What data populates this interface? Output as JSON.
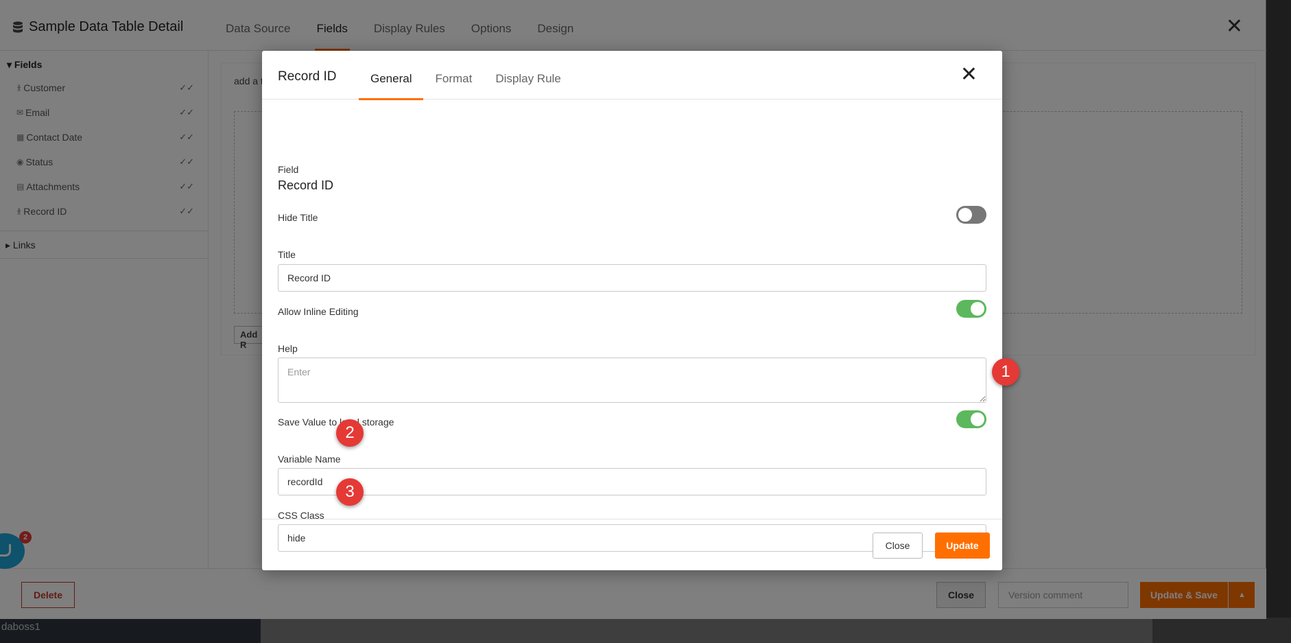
{
  "panel": {
    "title": "Sample Data Table Detail",
    "tabs": [
      "Data Source",
      "Fields",
      "Display Rules",
      "Options",
      "Design"
    ],
    "active_tab": "Fields",
    "close_glyph": "✕"
  },
  "sidebar": {
    "fields_heading": "Fields",
    "items": [
      {
        "label": "Customer",
        "icon": "person-icon"
      },
      {
        "label": "Email",
        "icon": "mail-icon"
      },
      {
        "label": "Contact Date",
        "icon": "calendar-icon"
      },
      {
        "label": "Status",
        "icon": "circle-dot-icon"
      },
      {
        "label": "Attachments",
        "icon": "file-icon"
      },
      {
        "label": "Record ID",
        "icon": "person-icon"
      }
    ],
    "links_heading": "Links"
  },
  "content": {
    "hint": "add a t",
    "add_button": "Add R"
  },
  "footer": {
    "delete": "Delete",
    "close": "Close",
    "version_placeholder": "Version comment",
    "update_save": "Update & Save"
  },
  "user_strip": "daboss1",
  "chat_badge": "2",
  "modal": {
    "title": "Record ID",
    "tabs": [
      "General",
      "Format",
      "Display Rule"
    ],
    "active_tab": "General",
    "field_label": "Field",
    "field_value": "Record ID",
    "hide_title_label": "Hide Title",
    "hide_title_on": false,
    "title_label": "Title",
    "title_value": "Record ID",
    "inline_edit_label": "Allow Inline Editing",
    "inline_edit_on": true,
    "help_label": "Help",
    "help_placeholder": "Enter",
    "save_local_label": "Save Value to local storage",
    "save_local_on": true,
    "variable_label": "Variable Name",
    "variable_value": "recordId",
    "css_label": "CSS Class",
    "css_value": "hide",
    "close_button": "Close",
    "update_button": "Update"
  },
  "markers": [
    "1",
    "2",
    "3"
  ],
  "colors": {
    "accent": "#ff6f00",
    "toggle_on": "#5cb85c",
    "marker": "#e53935"
  }
}
